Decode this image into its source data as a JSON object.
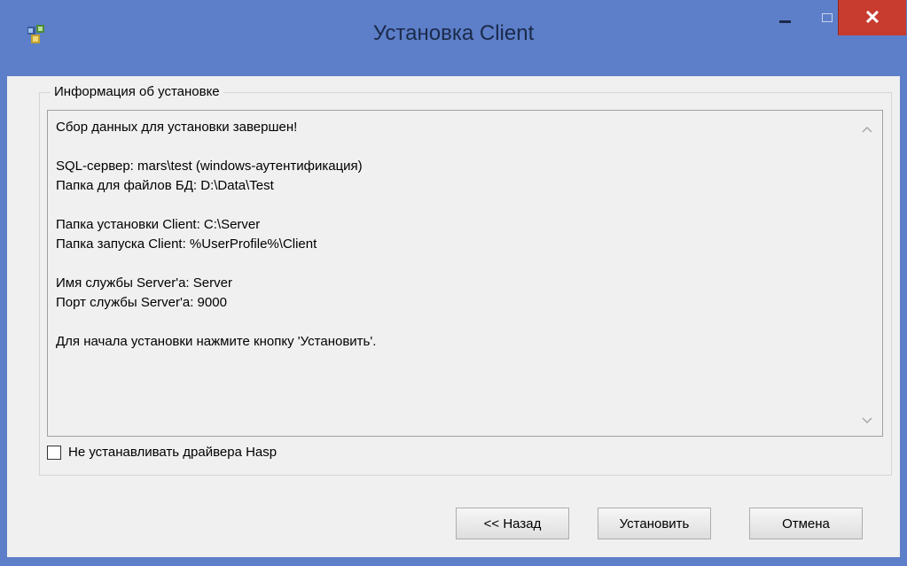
{
  "window": {
    "title": "Установка Client"
  },
  "titlebar": {
    "minimize_icon": "minimize-icon",
    "maximize_icon": "maximize-icon",
    "close_glyph": "✕"
  },
  "group": {
    "label": "Информация об установке",
    "lines": [
      "Сбор данных для установки завершен!",
      "",
      "SQL-сервер: mars\\test (windows-аутентификация)",
      "Папка для файлов БД: D:\\Data\\Test",
      "",
      "Папка установки Client: C:\\Server",
      "Папка запуска Client: %UserProfile%\\Client",
      "",
      "Имя службы Server'а: Server",
      "Порт службы Server'а: 9000",
      "",
      "Для начала установки нажмите кнопку 'Установить'."
    ]
  },
  "checkbox": {
    "label": "Не устанавливать драйвера Hasp",
    "checked": false
  },
  "buttons": {
    "back": "<< Назад",
    "install": "Установить",
    "cancel": "Отмена"
  },
  "colors": {
    "titlebar": "#5d7fc9",
    "close": "#c83c30",
    "client_bg": "#f0f0f0"
  }
}
